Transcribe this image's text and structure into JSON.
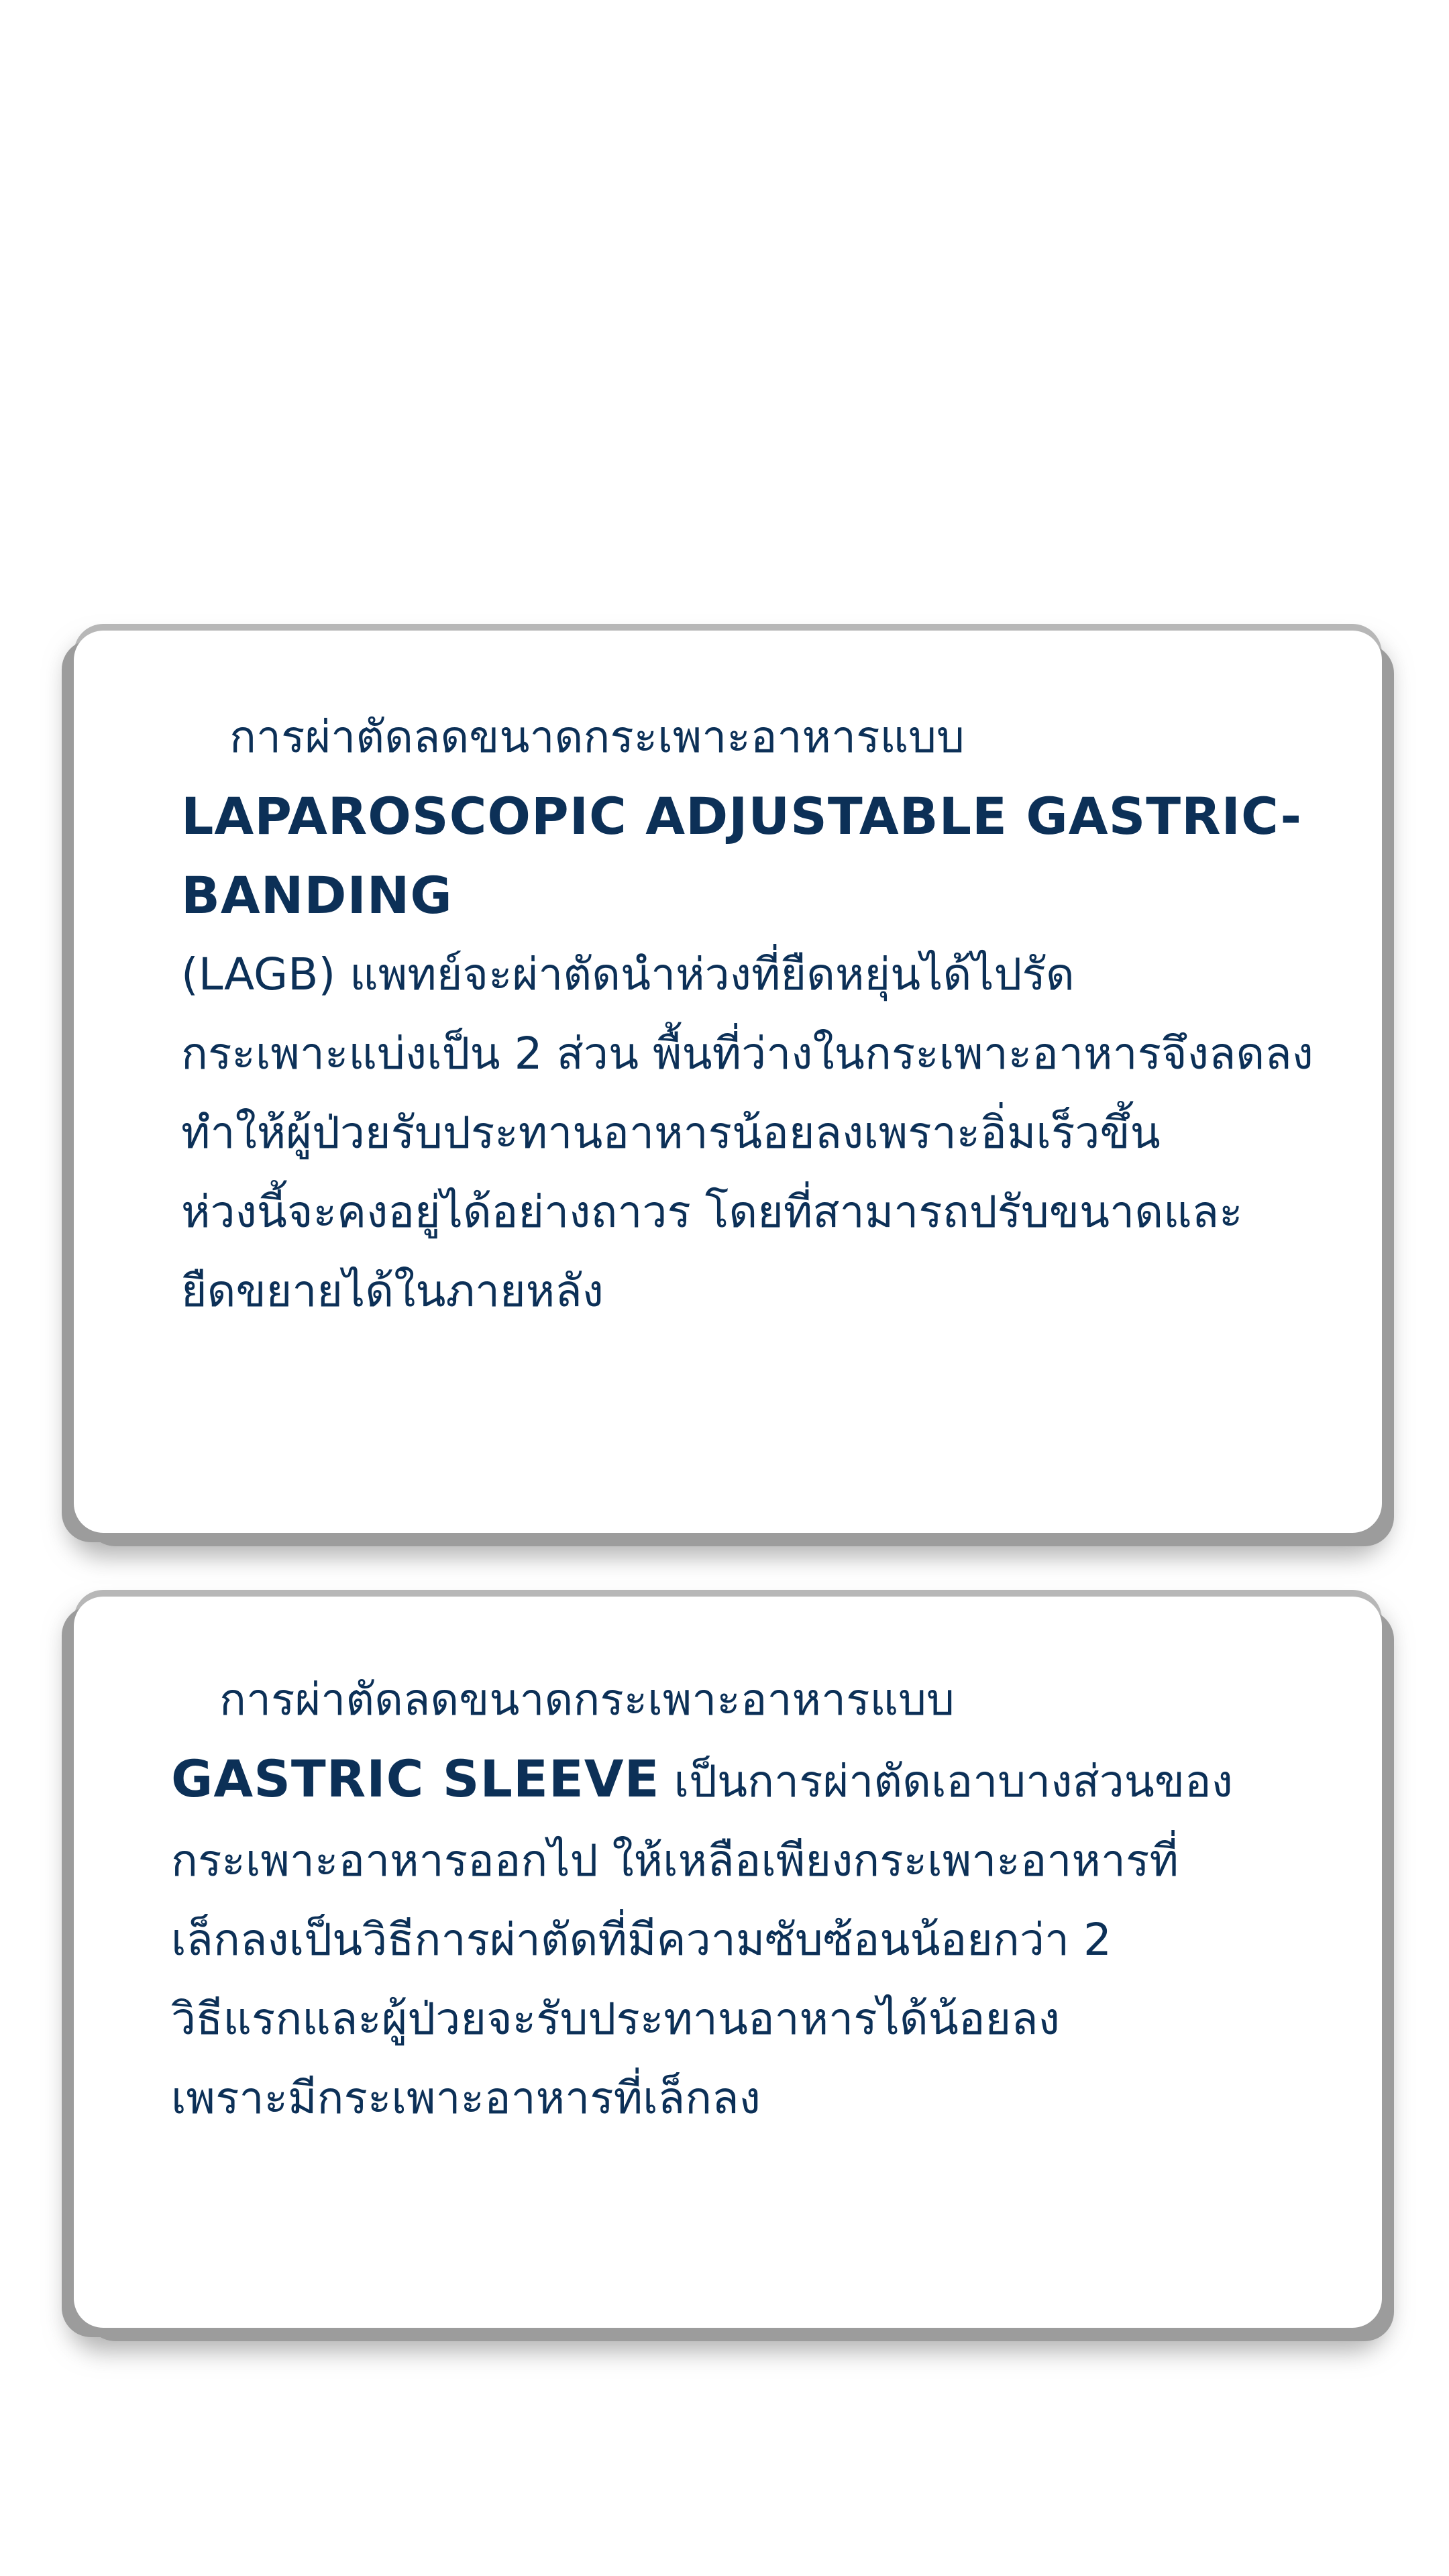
{
  "cards": [
    {
      "intro": "การผ่าตัดลดขนาดกระเพาะอาหารแบบ",
      "heading": "LAPAROSCOPIC ADJUSTABLE GASTRIC-\nBANDING",
      "body": [
        "(LAGB) แพทย์จะผ่าตัดนำห่วงที่ยืดหยุ่นได้ไปรัด",
        "กระเพาะแบ่งเป็น 2 ส่วน พื้นที่ว่างในกระเพาะอาหารจึงลดลง",
        "ทำให้ผู้ป่วยรับประทานอาหารน้อยลงเพราะอิ่มเร็วขึ้น",
        "ห่วงนี้จะคงอยู่ได้อย่างถาวร โดยที่สามารถปรับขนาดและ",
        "ยืดขยายได้ในภายหลัง"
      ]
    },
    {
      "intro": "การผ่าตัดลดขนาดกระเพาะอาหารแบบ",
      "heading": "GASTRIC SLEEVE",
      "heading_continuation": " เป็นการผ่าตัดเอาบางส่วนของ",
      "body": [
        "กระเพาะอาหารออกไป ให้เหลือเพียงกระเพาะอาหารที่",
        "เล็กลงเป็นวิธีการผ่าตัดที่มีความซับซ้อนน้อยกว่า 2",
        "วิธีแรกและผู้ป่วยจะรับประทานอาหารได้น้อยลง",
        "เพราะมีกระเพาะอาหารที่เล็กลง"
      ]
    }
  ]
}
